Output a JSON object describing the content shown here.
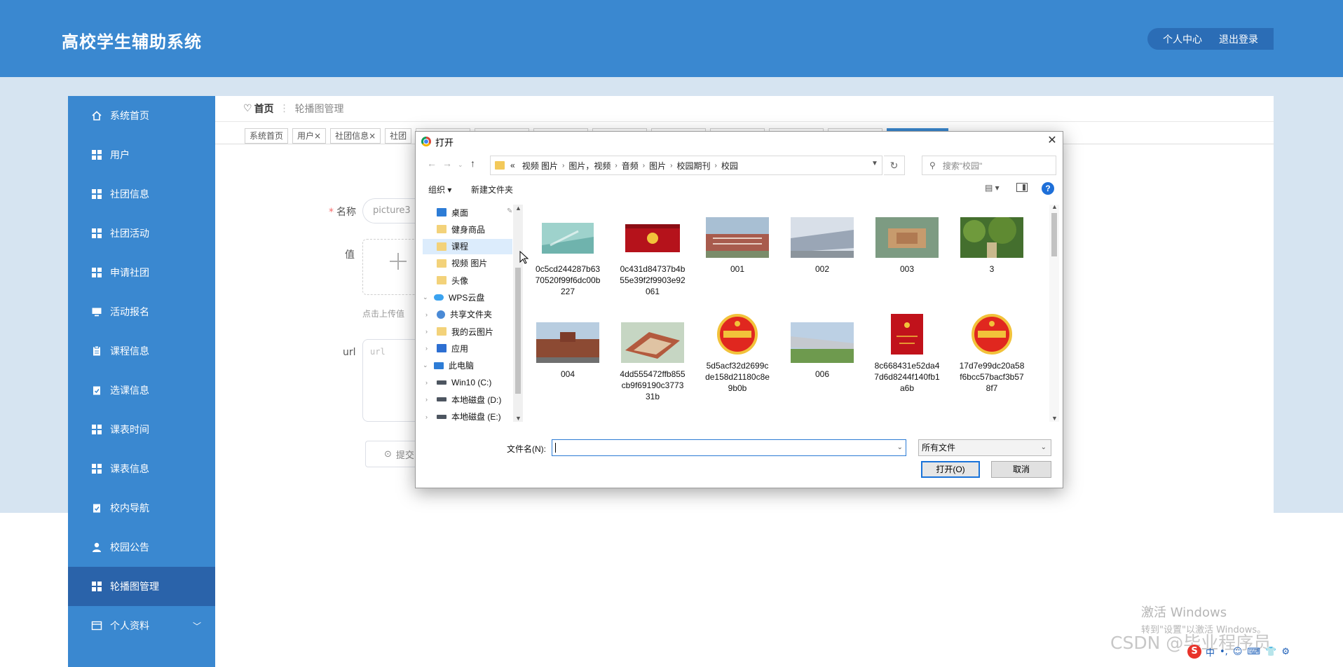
{
  "app": {
    "title": "高校学生辅助系统",
    "header_links": [
      "个人中心",
      "退出登录"
    ]
  },
  "sidebar": {
    "items": [
      {
        "label": "系统首页",
        "icon": "home-icon"
      },
      {
        "label": "用户",
        "icon": "grid-icon"
      },
      {
        "label": "社团信息",
        "icon": "grid-icon"
      },
      {
        "label": "社团活动",
        "icon": "grid-icon"
      },
      {
        "label": "申请社团",
        "icon": "grid-icon"
      },
      {
        "label": "活动报名",
        "icon": "monitor-icon"
      },
      {
        "label": "课程信息",
        "icon": "clipboard-icon"
      },
      {
        "label": "选课信息",
        "icon": "clipboard-check-icon"
      },
      {
        "label": "课表时间",
        "icon": "grid-icon"
      },
      {
        "label": "课表信息",
        "icon": "grid-icon"
      },
      {
        "label": "校内导航",
        "icon": "clipboard-icon"
      },
      {
        "label": "校园公告",
        "icon": "user-icon"
      },
      {
        "label": "轮播图管理",
        "icon": "grid-icon",
        "active": true
      },
      {
        "label": "个人资料",
        "icon": "profile-icon",
        "has_submenu": true
      }
    ]
  },
  "breadcrumb": {
    "home": "首页",
    "current": "轮播图管理"
  },
  "tabs": [
    "系统首页",
    "用户",
    "社团信息",
    "社团"
  ],
  "form": {
    "name_label": "名称",
    "name_value": "picture3",
    "value_label": "值",
    "upload_hint": "点击上传值",
    "url_label": "url",
    "url_placeholder": "url",
    "submit_label": "提交"
  },
  "dialog": {
    "title": "打开",
    "path": [
      "视频 图片",
      "图片，视频",
      "音频",
      "图片",
      "校园期刊",
      "校园"
    ],
    "path_prefix": "«",
    "search_placeholder": "搜索\"校园\"",
    "toolbar": {
      "organize": "组织 ▾",
      "new_folder": "新建文件夹"
    },
    "nav_tree": [
      {
        "label": "桌面",
        "icon": "desktop",
        "indent": 1
      },
      {
        "label": "健身商品",
        "icon": "folder",
        "indent": 1
      },
      {
        "label": "课程",
        "icon": "folder",
        "indent": 1,
        "selected": true
      },
      {
        "label": "视频 图片",
        "icon": "folder",
        "indent": 1
      },
      {
        "label": "头像",
        "icon": "folder",
        "indent": 1
      },
      {
        "label": "WPS云盘",
        "icon": "cloud",
        "indent": 0,
        "expanded": true
      },
      {
        "label": "共享文件夹",
        "icon": "share",
        "indent": 1
      },
      {
        "label": "我的云图片",
        "icon": "folder",
        "indent": 1
      },
      {
        "label": "应用",
        "icon": "apps",
        "indent": 1
      },
      {
        "label": "此电脑",
        "icon": "pc",
        "indent": 0,
        "expanded": true
      },
      {
        "label": "Win10 (C:)",
        "icon": "drive",
        "indent": 1
      },
      {
        "label": "本地磁盘 (D:)",
        "icon": "drive",
        "indent": 1
      },
      {
        "label": "本地磁盘 (E:)",
        "icon": "drive",
        "indent": 1
      }
    ],
    "files": [
      {
        "name": "0c5cd244287b6370520f99f6dc00b227",
        "thumb": "card"
      },
      {
        "name": "0c431d84737b4b55e39f2f9903e92061",
        "thumb": "red-book"
      },
      {
        "name": "001",
        "thumb": "campus-building"
      },
      {
        "name": "002",
        "thumb": "campus-modern"
      },
      {
        "name": "003",
        "thumb": "campus-aerial"
      },
      {
        "name": "3",
        "thumb": "trees"
      },
      {
        "name": "004",
        "thumb": "campus-brick"
      },
      {
        "name": "4dd555472ffb855cb9f69190c377331b",
        "thumb": "campus-model"
      },
      {
        "name": "5d5acf32d2699cde158d21180c8e9b0b",
        "thumb": "youth-badge"
      },
      {
        "name": "006",
        "thumb": "campus-green"
      },
      {
        "name": "8c668431e52da47d6d8244f140fb1a6b",
        "thumb": "red-cert"
      },
      {
        "name": "17d7e99dc20a58f6bcc57bacf3b578f7",
        "thumb": "youth-badge"
      }
    ],
    "filename_label": "文件名(N):",
    "filename_value": "",
    "filetype": "所有文件",
    "open_label": "打开(O)",
    "cancel_label": "取消"
  },
  "overlay": {
    "activate_line1": "激活 Windows",
    "activate_line2": "转到\"设置\"以激活 Windows。",
    "csdn": "CSDN @毕业程序员",
    "ime": [
      "中",
      "•,",
      "☺",
      "⌨",
      "👕",
      "⚙"
    ]
  }
}
